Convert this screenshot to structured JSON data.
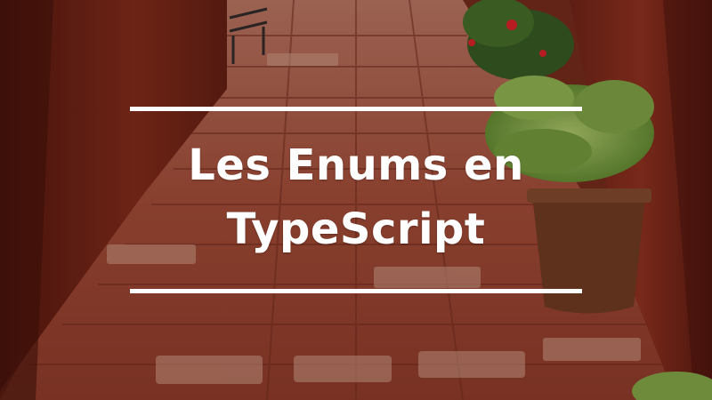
{
  "title": {
    "line1": "Les Enums en",
    "line2": "TypeScript"
  },
  "colors": {
    "wall": "#7a2a1b",
    "wall_dark": "#4a160e",
    "path": "#9b4a36",
    "stone_light": "#b8806a",
    "plant": "#6f9a3a",
    "plant_dark": "#2f5a22",
    "pot": "#6a3a22",
    "flower": "#d8202a",
    "text": "#ffffff"
  }
}
